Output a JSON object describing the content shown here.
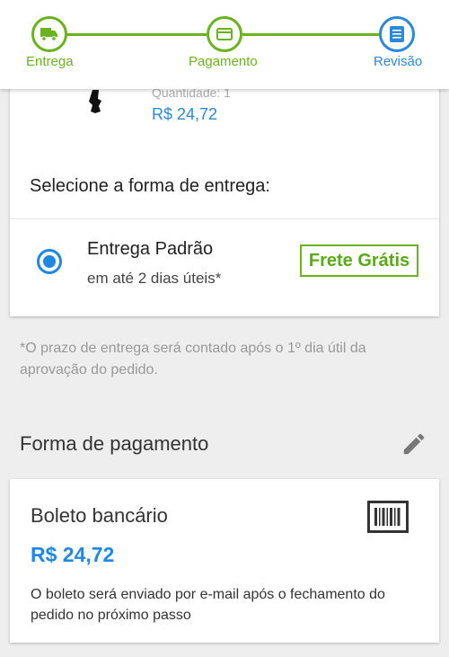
{
  "stepper": {
    "steps": [
      {
        "label": "Entrega",
        "icon": "truck-icon",
        "state": "done"
      },
      {
        "label": "Pagamento",
        "icon": "card-icon",
        "state": "done"
      },
      {
        "label": "Revisão",
        "icon": "list-icon",
        "state": "active"
      }
    ]
  },
  "colors": {
    "green": "#6ab31f",
    "blue": "#2c88d9",
    "background": "#eeeeee"
  },
  "delivery": {
    "quantity_label": "Quantidade: 1",
    "item_price": "R$ 24,72",
    "heading": "Selecione a forma de entrega:",
    "option": {
      "name": "Entrega Padrão",
      "time": "em até 2 dias úteis*",
      "badge": "Frete Grátis",
      "selected": true
    }
  },
  "footnote": "*O prazo de entrega será contado após o 1º dia útil da aprovação do pedido.",
  "payment": {
    "section_title": "Forma de pagamento",
    "method": "Boleto bancário",
    "amount": "R$ 24,72",
    "note": "O boleto será enviado por e-mail após o fechamento do pedido no próximo passo"
  }
}
